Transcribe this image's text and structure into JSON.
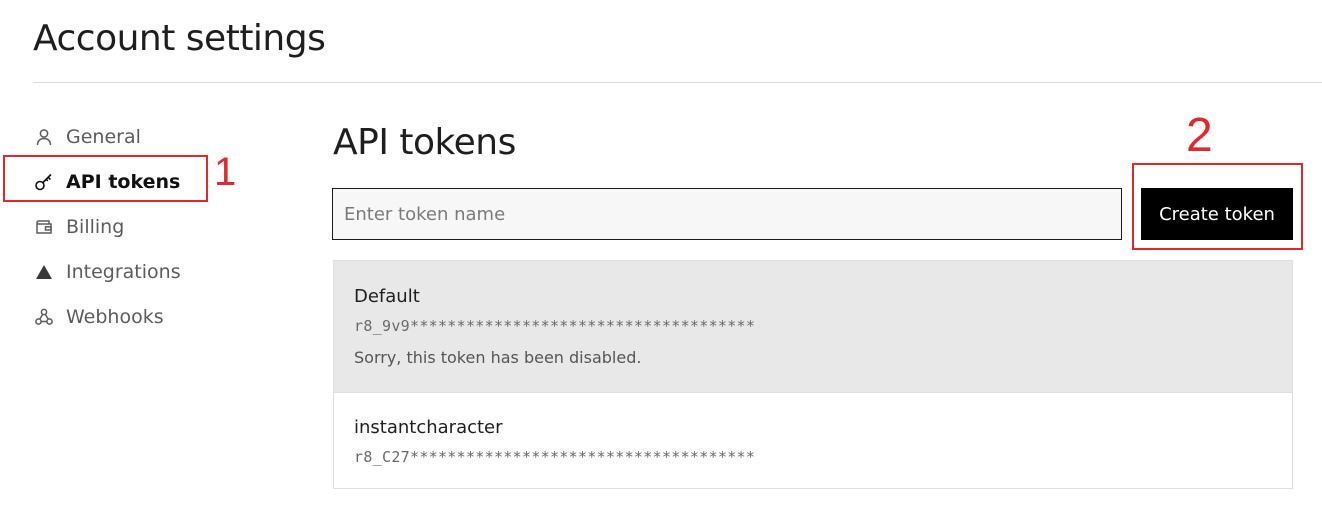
{
  "page": {
    "title": "Account settings"
  },
  "sidebar": {
    "items": [
      {
        "label": "General",
        "icon": "user-icon",
        "active": false
      },
      {
        "label": "API tokens",
        "icon": "key-icon",
        "active": true
      },
      {
        "label": "Billing",
        "icon": "wallet-icon",
        "active": false
      },
      {
        "label": "Integrations",
        "icon": "triangle-icon",
        "active": false
      },
      {
        "label": "Webhooks",
        "icon": "webhook-icon",
        "active": false
      }
    ]
  },
  "annotations": [
    {
      "number": "1",
      "color": "#e2282f"
    },
    {
      "number": "2",
      "color": "#e2282f"
    }
  ],
  "main": {
    "title": "API tokens",
    "input": {
      "placeholder": "Enter token name",
      "value": ""
    },
    "create_button": "Create token",
    "tokens": [
      {
        "name": "Default",
        "value": "r8_9v9*************************************",
        "note": "Sorry, this token has been disabled.",
        "disabled": true
      },
      {
        "name": "instantcharacter",
        "value": "r8_C27*************************************",
        "disabled": false
      }
    ]
  }
}
